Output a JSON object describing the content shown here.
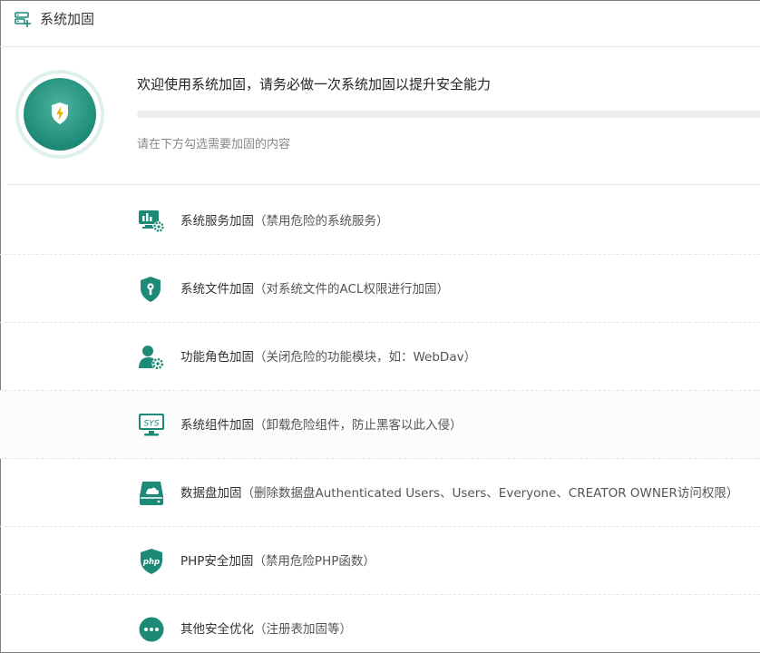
{
  "titlebar": {
    "title": "系统加固",
    "icon": "server-shield-icon"
  },
  "hero": {
    "badge_icon": "shield-lightning-icon",
    "welcome": "欢迎使用系统加固，请务必做一次系统加固以提升安全能力",
    "progress": 0,
    "hint": "请在下方勾选需要加固的内容"
  },
  "colors": {
    "accent": "#1d8a78",
    "text": "#333333",
    "muted": "#888888"
  },
  "items": [
    {
      "icon": "service-monitor-icon",
      "title": "系统服务加固",
      "desc": "（禁用危险的系统服务）"
    },
    {
      "icon": "file-shield-icon",
      "title": "系统文件加固",
      "desc": "（对系统文件的ACL权限进行加固）"
    },
    {
      "icon": "user-gear-icon",
      "title": "功能角色加固",
      "desc": "（关闭危险的功能模块，如：WebDav）"
    },
    {
      "icon": "sys-monitor-icon",
      "title": "系统组件加固",
      "desc": "（卸载危险组件，防止黑客以此入侵）"
    },
    {
      "icon": "disk-cloud-icon",
      "title": "数据盘加固",
      "desc": "（删除数据盘Authenticated Users、Users、Everyone、CREATOR OWNER访问权限）"
    },
    {
      "icon": "php-shield-icon",
      "title": "PHP安全加固",
      "desc": "（禁用危险PHP函数）"
    },
    {
      "icon": "more-dots-icon",
      "title": "其他安全优化",
      "desc": "（注册表加固等）"
    }
  ]
}
